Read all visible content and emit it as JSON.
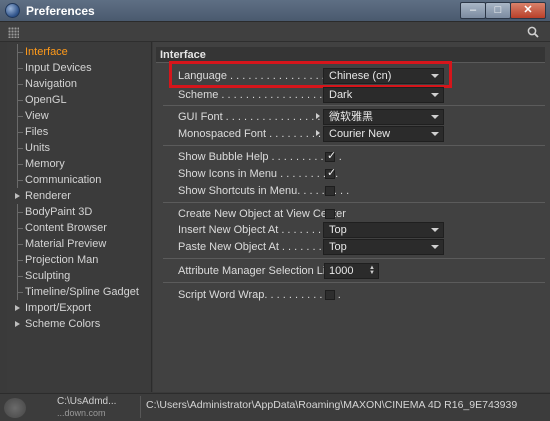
{
  "window": {
    "title": "Preferences",
    "min_label": "–",
    "max_label": "□",
    "close_label": "✕"
  },
  "sidebar": {
    "items": [
      {
        "label": "Interface",
        "active": true
      },
      {
        "label": "Input Devices"
      },
      {
        "label": "Navigation"
      },
      {
        "label": "OpenGL"
      },
      {
        "label": "View"
      },
      {
        "label": "Files"
      },
      {
        "label": "Units"
      },
      {
        "label": "Memory"
      },
      {
        "label": "Communication"
      },
      {
        "label": "Renderer",
        "expandable": true
      },
      {
        "label": "BodyPaint 3D"
      },
      {
        "label": "Content Browser"
      },
      {
        "label": "Material Preview"
      },
      {
        "label": "Projection Man"
      },
      {
        "label": "Sculpting"
      },
      {
        "label": "Timeline/Spline Gadget"
      },
      {
        "label": "Import/Export",
        "expandable": true
      },
      {
        "label": "Scheme Colors",
        "expandable": true
      }
    ]
  },
  "main": {
    "section_title": "Interface",
    "language": {
      "label": "Language . . . . . . . . . . . . . . . . . .",
      "value": "Chinese (cn)"
    },
    "scheme": {
      "label": "Scheme . . . . . . . . . . . . . . . . . . . .",
      "value": "Dark"
    },
    "gui_font": {
      "label": "GUI Font . . . . . . . . . . . . . . . .",
      "value": "微软雅黑"
    },
    "mono_font": {
      "label": "Monospaced Font . . . . . . . . . . .",
      "value": "Courier New"
    },
    "bubble_help": {
      "label": "Show Bubble Help . . . . . . . . . . . .",
      "checked": true
    },
    "icons_in_menu": {
      "label": "Show Icons in Menu . . . . . . . . . .",
      "checked": true
    },
    "shortcuts_in_menu": {
      "label": "Show Shortcuts in Menu. . . . . . . . .",
      "checked": false
    },
    "create_at_center": {
      "label": "Create New Object at View Center",
      "checked": false
    },
    "insert_new_at": {
      "label": "Insert New Object At . . . . . . . . . .",
      "value": "Top"
    },
    "paste_new_at": {
      "label": "Paste New Object At . . . . . . . . . .",
      "value": "Top"
    },
    "attr_limit": {
      "label": "Attribute Manager Selection Limit",
      "value": "1000"
    },
    "script_wrap": {
      "label": "Script Word Wrap. . . . . . . . . . . . .",
      "checked": false
    }
  },
  "statusbar": {
    "left_label": "C:\\UsAdmd...",
    "left_sub": "...down.com",
    "path": "C:\\Users\\Administrator\\AppData\\Roaming\\MAXON\\CINEMA 4D R16_9E743939"
  },
  "icons": {
    "check_glyph": "✓"
  },
  "colors": {
    "accent": "#ff9a1a",
    "highlight_box": "#d6151b"
  }
}
